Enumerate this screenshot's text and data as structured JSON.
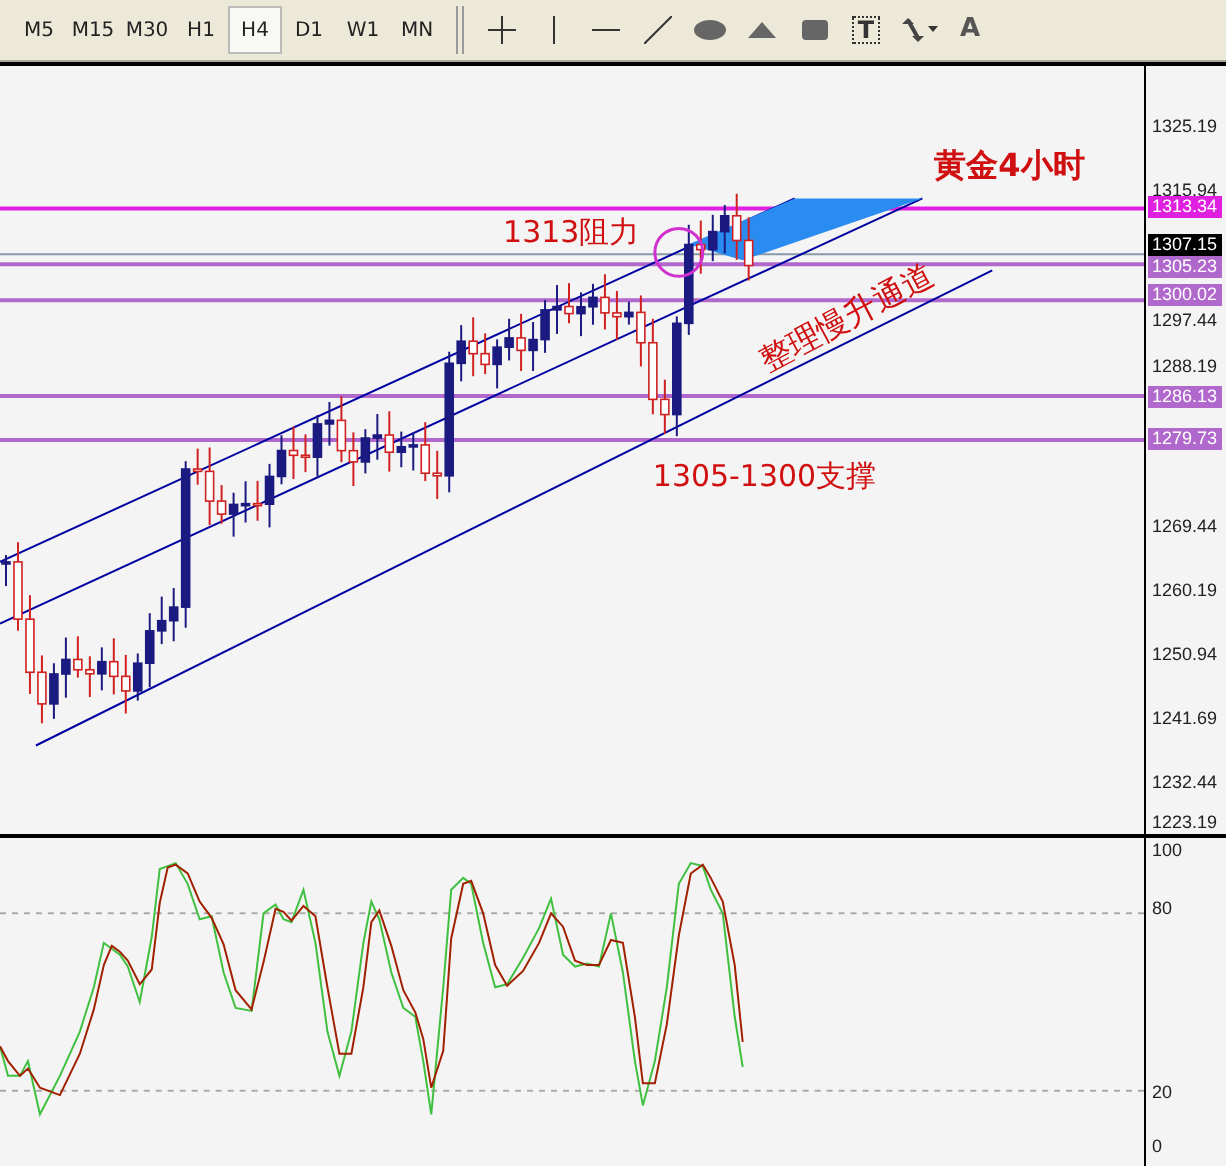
{
  "toolbar": {
    "timeframes": [
      {
        "label": "M5",
        "selected": false
      },
      {
        "label": "M15",
        "selected": false
      },
      {
        "label": "M30",
        "selected": false
      },
      {
        "label": "H1",
        "selected": false
      },
      {
        "label": "H4",
        "selected": true
      },
      {
        "label": "D1",
        "selected": false
      },
      {
        "label": "W1",
        "selected": false
      },
      {
        "label": "MN",
        "selected": false
      }
    ],
    "tools": [
      {
        "kind": "crosshair"
      },
      {
        "kind": "vline"
      },
      {
        "kind": "hline"
      },
      {
        "kind": "trendline"
      },
      {
        "kind": "ellipse"
      },
      {
        "kind": "triangle"
      },
      {
        "kind": "rectangle"
      },
      {
        "kind": "textbox",
        "label": "T"
      },
      {
        "kind": "arrows"
      },
      {
        "kind": "label",
        "label": "A"
      }
    ]
  },
  "price_chart": {
    "axis_ticks": [
      "1325.19",
      "1315.94",
      "1297.44",
      "1288.19",
      "1269.44",
      "1260.19",
      "1250.94",
      "1241.69",
      "1232.44",
      "1223.19"
    ],
    "current_price": "1307.15",
    "levels": [
      {
        "price": "1313.34",
        "color": "#e020e0"
      },
      {
        "price": "1305.23",
        "color": "#b068cc"
      },
      {
        "price": "1300.02",
        "color": "#b068cc"
      },
      {
        "price": "1286.13",
        "color": "#b068cc"
      },
      {
        "price": "1279.73",
        "color": "#b068cc"
      }
    ],
    "annotations": [
      {
        "kind": "title",
        "text": "黄金4小时"
      },
      {
        "kind": "resistance",
        "text": "1313阻力"
      },
      {
        "kind": "channel",
        "text": "整理慢升通道"
      },
      {
        "kind": "support",
        "text": "1305-1300支撑"
      }
    ]
  },
  "oscillator": {
    "axis_ticks": [
      "100",
      "80",
      "20",
      "0"
    ]
  }
}
